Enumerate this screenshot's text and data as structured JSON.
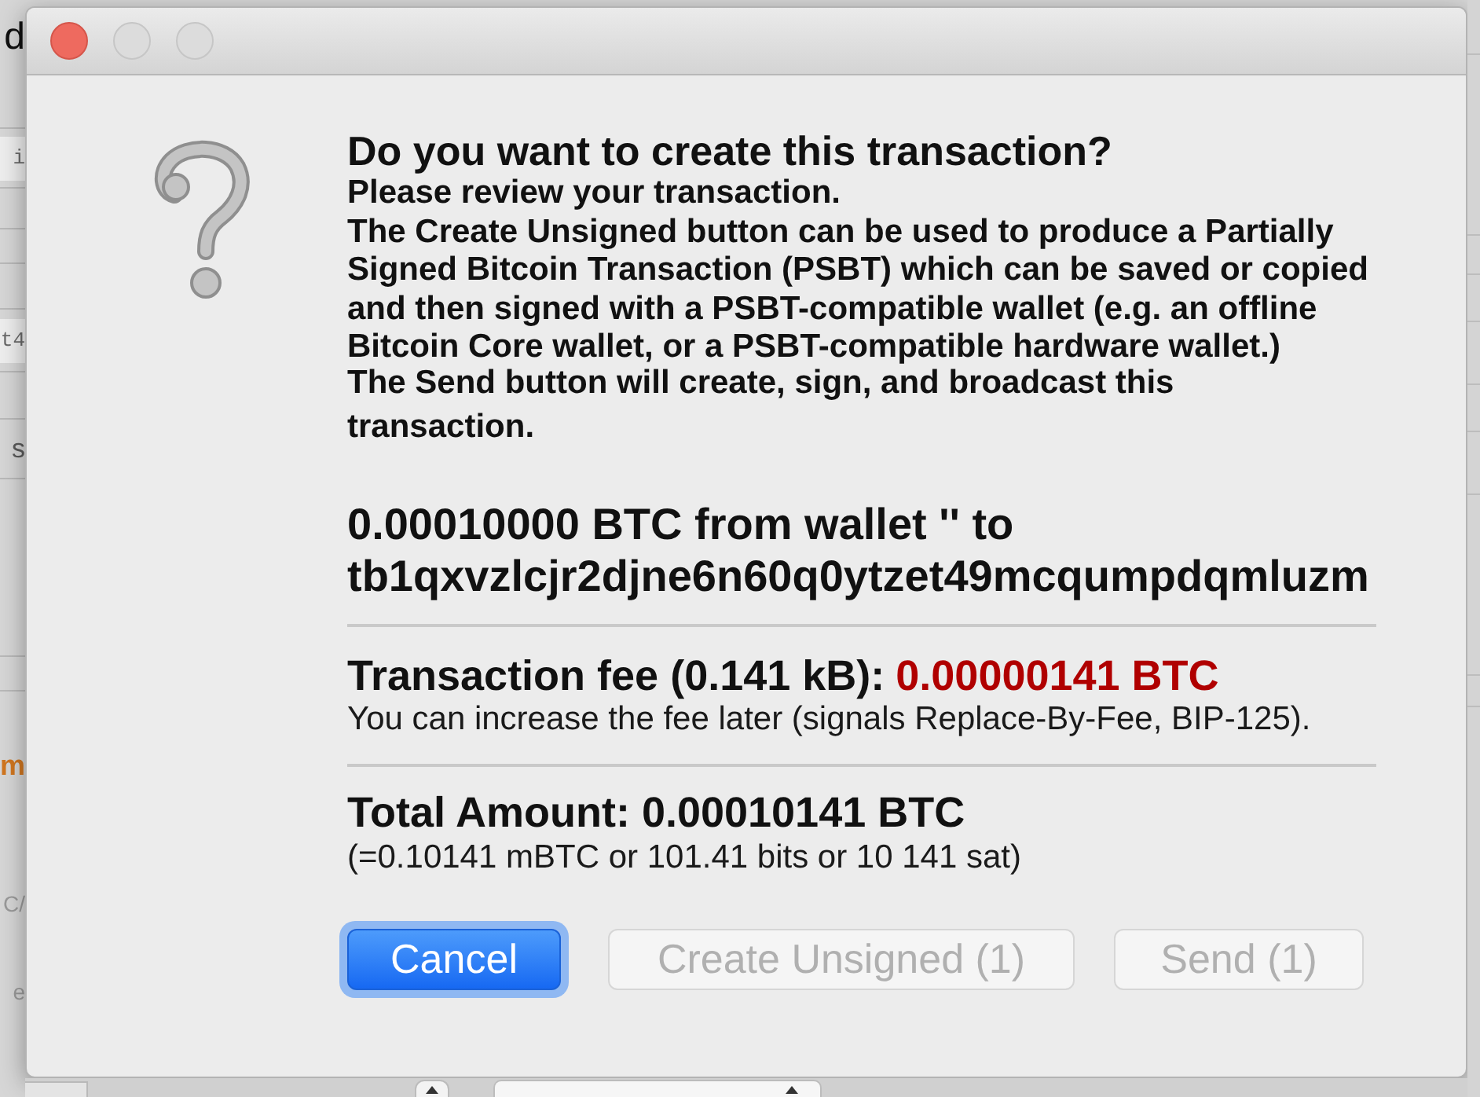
{
  "background_window": {
    "fragments": [
      {
        "text": "d",
        "kind": "title"
      },
      {
        "text": "i",
        "kind": "field"
      },
      {
        "text": "t4",
        "kind": "field"
      },
      {
        "text": "s",
        "kind": "label"
      },
      {
        "text": "m",
        "kind": "accent"
      },
      {
        "text": "C/",
        "kind": "hint"
      },
      {
        "text": "e",
        "kind": "hint"
      }
    ]
  },
  "dialog": {
    "window_controls": [
      {
        "kind": "close",
        "disabled": false
      },
      {
        "kind": "minimize",
        "disabled": true
      },
      {
        "kind": "zoom",
        "disabled": true
      }
    ],
    "question": "Do you want to create this transaction?",
    "paragraphs": [
      "Please review your transaction.",
      "The Create Unsigned button can be used to produce a Partially Signed Bitcoin Transaction (PSBT) which can be saved or copied and then signed with a PSBT-compatible wallet (e.g. an offline Bitcoin Core wallet, or a PSBT-compatible hardware wallet.)",
      "The Send button will create, sign, and broadcast this transaction."
    ],
    "recipient": {
      "summary": "0.00010000 BTC from wallet '' to",
      "address": "tb1qxvzlcjr2djne6n60q0ytzet49mcqumpdqmluzm"
    },
    "fee": {
      "label": "Transaction fee (0.141 kB):",
      "amount": "0.00000141 BTC",
      "note": "You can increase the fee later (signals Replace-By-Fee, BIP-125)."
    },
    "total": {
      "label": "Total Amount: 0.00010141 BTC",
      "note": "(=0.10141 mBTC or 101.41 bits or 10 141 sat)"
    },
    "buttons": [
      {
        "label": "Cancel",
        "kind": "default",
        "disabled": false
      },
      {
        "label": "Create Unsigned (1)",
        "kind": "normal",
        "disabled": true
      },
      {
        "label": "Send (1)",
        "kind": "normal",
        "disabled": true
      }
    ]
  }
}
